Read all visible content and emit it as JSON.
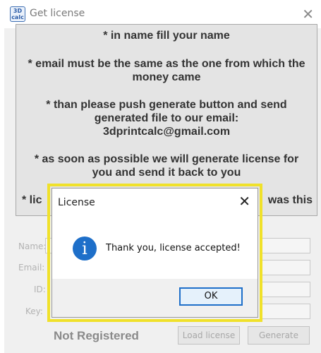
{
  "window": {
    "title": "Get license",
    "app_icon_text": "3D calc",
    "close_glyph": "✕"
  },
  "info": {
    "lines": [
      "* in name fill your name",
      "* email must be the same as the one from which the",
      "money came",
      "* than please push generate button and send",
      "generated file to our email:",
      "3dprintcalc@gmail.com",
      "* as soon as possible we will generate license for",
      "you and send it back to you",
      "* lic",
      "was this"
    ]
  },
  "form": {
    "name_label": "Name:",
    "email_label": "Email:",
    "id_label": "ID:",
    "key_label": "Key:",
    "name_value": "",
    "email_value": "",
    "id_value": "",
    "key_value": ""
  },
  "footer": {
    "status": "Not Registered",
    "load_license_label": "Load license",
    "generate_label": "Generate"
  },
  "dialog": {
    "title": "License",
    "close_glyph": "✕",
    "icon_glyph": "i",
    "message": "Thank you, license accepted!",
    "ok_label": "OK"
  },
  "colors": {
    "highlight": "#f0e12a",
    "info_icon": "#1e6fc9",
    "ok_border": "#1e6fc9"
  }
}
